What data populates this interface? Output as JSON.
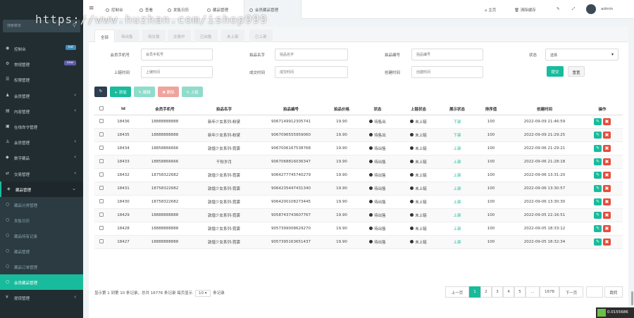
{
  "watermark": "https://www.huzhan.com/ishop999",
  "sidebar": {
    "search_placeholder": "搜索菜单",
    "search_icon": "search-icon",
    "items": [
      {
        "label": "控制台",
        "icon": "dashboard-icon",
        "badge": "hot",
        "badge_color": "#3c8dbc"
      },
      {
        "label": "常规管理",
        "icon": "cog-icon",
        "badge": "new",
        "badge_color": "#605ca8"
      },
      {
        "label": "权限管理",
        "icon": "group-icon"
      },
      {
        "label": "会员管理",
        "icon": "user-icon"
      },
      {
        "label": "内容管理",
        "icon": "file-icon"
      },
      {
        "label": "在线命令管理",
        "icon": "terminal-icon"
      },
      {
        "label": "会员管理",
        "icon": "users-icon"
      },
      {
        "label": "数字藏品",
        "icon": "cube-icon"
      },
      {
        "label": "交易管理",
        "icon": "exchange-icon"
      },
      {
        "label": "藏品管理",
        "icon": "cubes-icon"
      },
      {
        "label": "藏品分类管理",
        "icon": "circle-icon"
      },
      {
        "label": "发售日历",
        "icon": "circle-icon"
      },
      {
        "label": "藏品持有记录",
        "icon": "circle-icon"
      },
      {
        "label": "藏品管理",
        "icon": "circle-icon"
      },
      {
        "label": "藏品订单管理",
        "icon": "circle-icon"
      },
      {
        "label": "会员藏品管理",
        "icon": "circle-icon"
      },
      {
        "label": "提现管理",
        "icon": "money-icon"
      }
    ]
  },
  "topbar": {
    "tabs": [
      "控制台",
      "查看",
      "发售日历",
      "藏品管理",
      "会员藏品管理"
    ],
    "home": "主页",
    "clear_cache": "清除缓存",
    "user": "admin"
  },
  "status_tabs": [
    "全部",
    "待出售",
    "待交易",
    "交易中",
    "已出售",
    "未上架",
    "已上架"
  ],
  "filters": {
    "phone_label": "会员手机号",
    "phone_placeholder": "会员手机号",
    "name_label": "拍品名字",
    "name_placeholder": "拍品名字",
    "number_label": "拍品编号",
    "number_placeholder": "拍品编号",
    "status_label": "状态",
    "status_value": "选择",
    "start_label": "上链时间",
    "start_placeholder": "上链时间",
    "end_label": "成交时间",
    "end_placeholder": "成交时间",
    "created_label": "创建时间",
    "created_placeholder": "创建时间",
    "submit": "提交",
    "reset": "重置"
  },
  "toolbar": {
    "refresh_icon": "refresh-icon",
    "add": "添加",
    "edit": "编辑",
    "delete": "删除",
    "upload": "上链"
  },
  "table": {
    "headers": [
      "",
      "Id",
      "会员手机号",
      "拍品名字",
      "拍品编号",
      "拍品价格",
      "状态",
      "上链状态",
      "展示状态",
      "排序值",
      "创建时间",
      "操作"
    ],
    "rows": [
      [
        "18436",
        "18888888888",
        "新年少女系列-粉黛",
        "9067149912305741",
        "19.90",
        "待售出",
        "未上链",
        "下架",
        "100",
        "2022-09-09 21:46:59"
      ],
      [
        "18435",
        "18888888888",
        "新年少女系列-粉黛",
        "9067096555959060",
        "19.90",
        "待售出",
        "未上链",
        "下架",
        "100",
        "2022-09-09 21:29:25"
      ],
      [
        "18434",
        "18858866666",
        "敦煌少女系列-霓裳",
        "9067006167538768",
        "19.90",
        "待出售",
        "未上链",
        "上架",
        "100",
        "2022-09-06 21:29:21"
      ],
      [
        "18433",
        "18858866666",
        "千秋岁月",
        "9067068816036347",
        "19.90",
        "待出售",
        "未上链",
        "上架",
        "100",
        "2022-09-06 21:28:18"
      ],
      [
        "18432",
        "18758322682",
        "敦煌少女系列-霓裳",
        "9064277745740279",
        "19.90",
        "待出售",
        "未上链",
        "上架",
        "100",
        "2022-09-06 13:31:20"
      ],
      [
        "18431",
        "18758322682",
        "敦煌少女系列-霓裳",
        "9064235447431340",
        "19.90",
        "待出售",
        "未上链",
        "上架",
        "100",
        "2022-09-06 13:30:57"
      ],
      [
        "18430",
        "18758322682",
        "敦煌少女系列-霓裳",
        "9064200108273445",
        "19.90",
        "待出售",
        "未上链",
        "上架",
        "100",
        "2022-09-06 13:30:30"
      ],
      [
        "18429",
        "18888888888",
        "敦煌少女系列-霓裳",
        "9058743743607767",
        "19.90",
        "待出售",
        "未上链",
        "上架",
        "100",
        "2022-09-05 22:16:51"
      ],
      [
        "18428",
        "18888888888",
        "敦煌少女系列-霓裳",
        "9057399008629270",
        "19.90",
        "待出售",
        "未上链",
        "上架",
        "100",
        "2022-09-05 18:33:12"
      ],
      [
        "18427",
        "18888888888",
        "敦煌少女系列-霓裳",
        "9057395163651437",
        "19.90",
        "待出售",
        "未上链",
        "上架",
        "100",
        "2022-09-05 18:32:34"
      ]
    ]
  },
  "pagination": {
    "info_prefix": "显示第 1 到第 10 条记录，总共 16776 条记录 每页显示",
    "page_size": "10",
    "info_suffix": "条记录",
    "prev": "上一页",
    "pages": [
      "1",
      "2",
      "3",
      "4",
      "5",
      "...",
      "1678"
    ],
    "next": "下一页",
    "goto": "跳转"
  },
  "corner_badge": "0.0155686",
  "colors": {
    "sidebar": "#222d32",
    "accent": "#18bc9c",
    "danger": "#e74c3c",
    "info": "#3c8dbc"
  }
}
